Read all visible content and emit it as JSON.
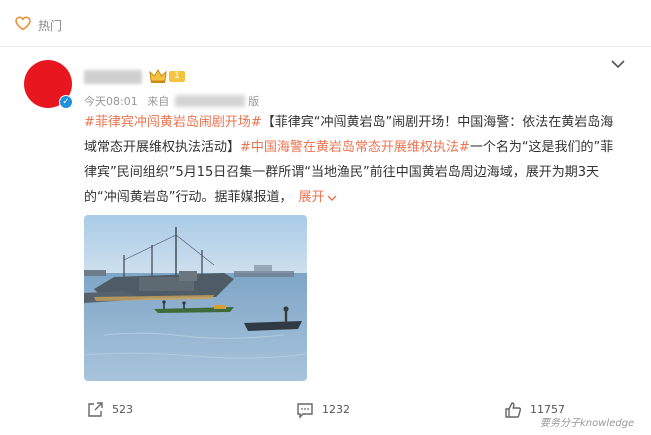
{
  "header": {
    "label": "热门",
    "icon": "heart-outline-icon"
  },
  "post": {
    "username": "■■■■■",
    "time": "今天08:01",
    "source_prefix": "来自",
    "source_value": "■■■■■",
    "source_suffix": "版",
    "vip_level": "1",
    "text": {
      "hashtag1": "#菲律宾冲闯黄岩岛闹剧开场#",
      "body1": "【菲律宾“冲闯黄岩岛”闹剧开场！中国海警：依法在黄岩岛海域常态开展维权执法活动】",
      "hashtag2": "#中国海警在黄岩岛常态开展维权执法#",
      "body2": "一个名为“这是我们的”菲律宾”民间组织”5月15日召集一群所谓“当地渔民”前往中国黄岩岛周边海域，展开为期3天的“冲闯黄岩岛”行动。据菲媒报道，",
      "expand": "展开"
    },
    "image_subject": "fishing boats on the sea"
  },
  "actions": {
    "share_count": "523",
    "comment_count": "1232",
    "like_count": "11757"
  },
  "watermark": "要务分子knowledge",
  "colors": {
    "hashtag": "#eb7350",
    "avatar": "#e8161f",
    "verified": "#1e90e0",
    "vip": "#f6c341"
  }
}
